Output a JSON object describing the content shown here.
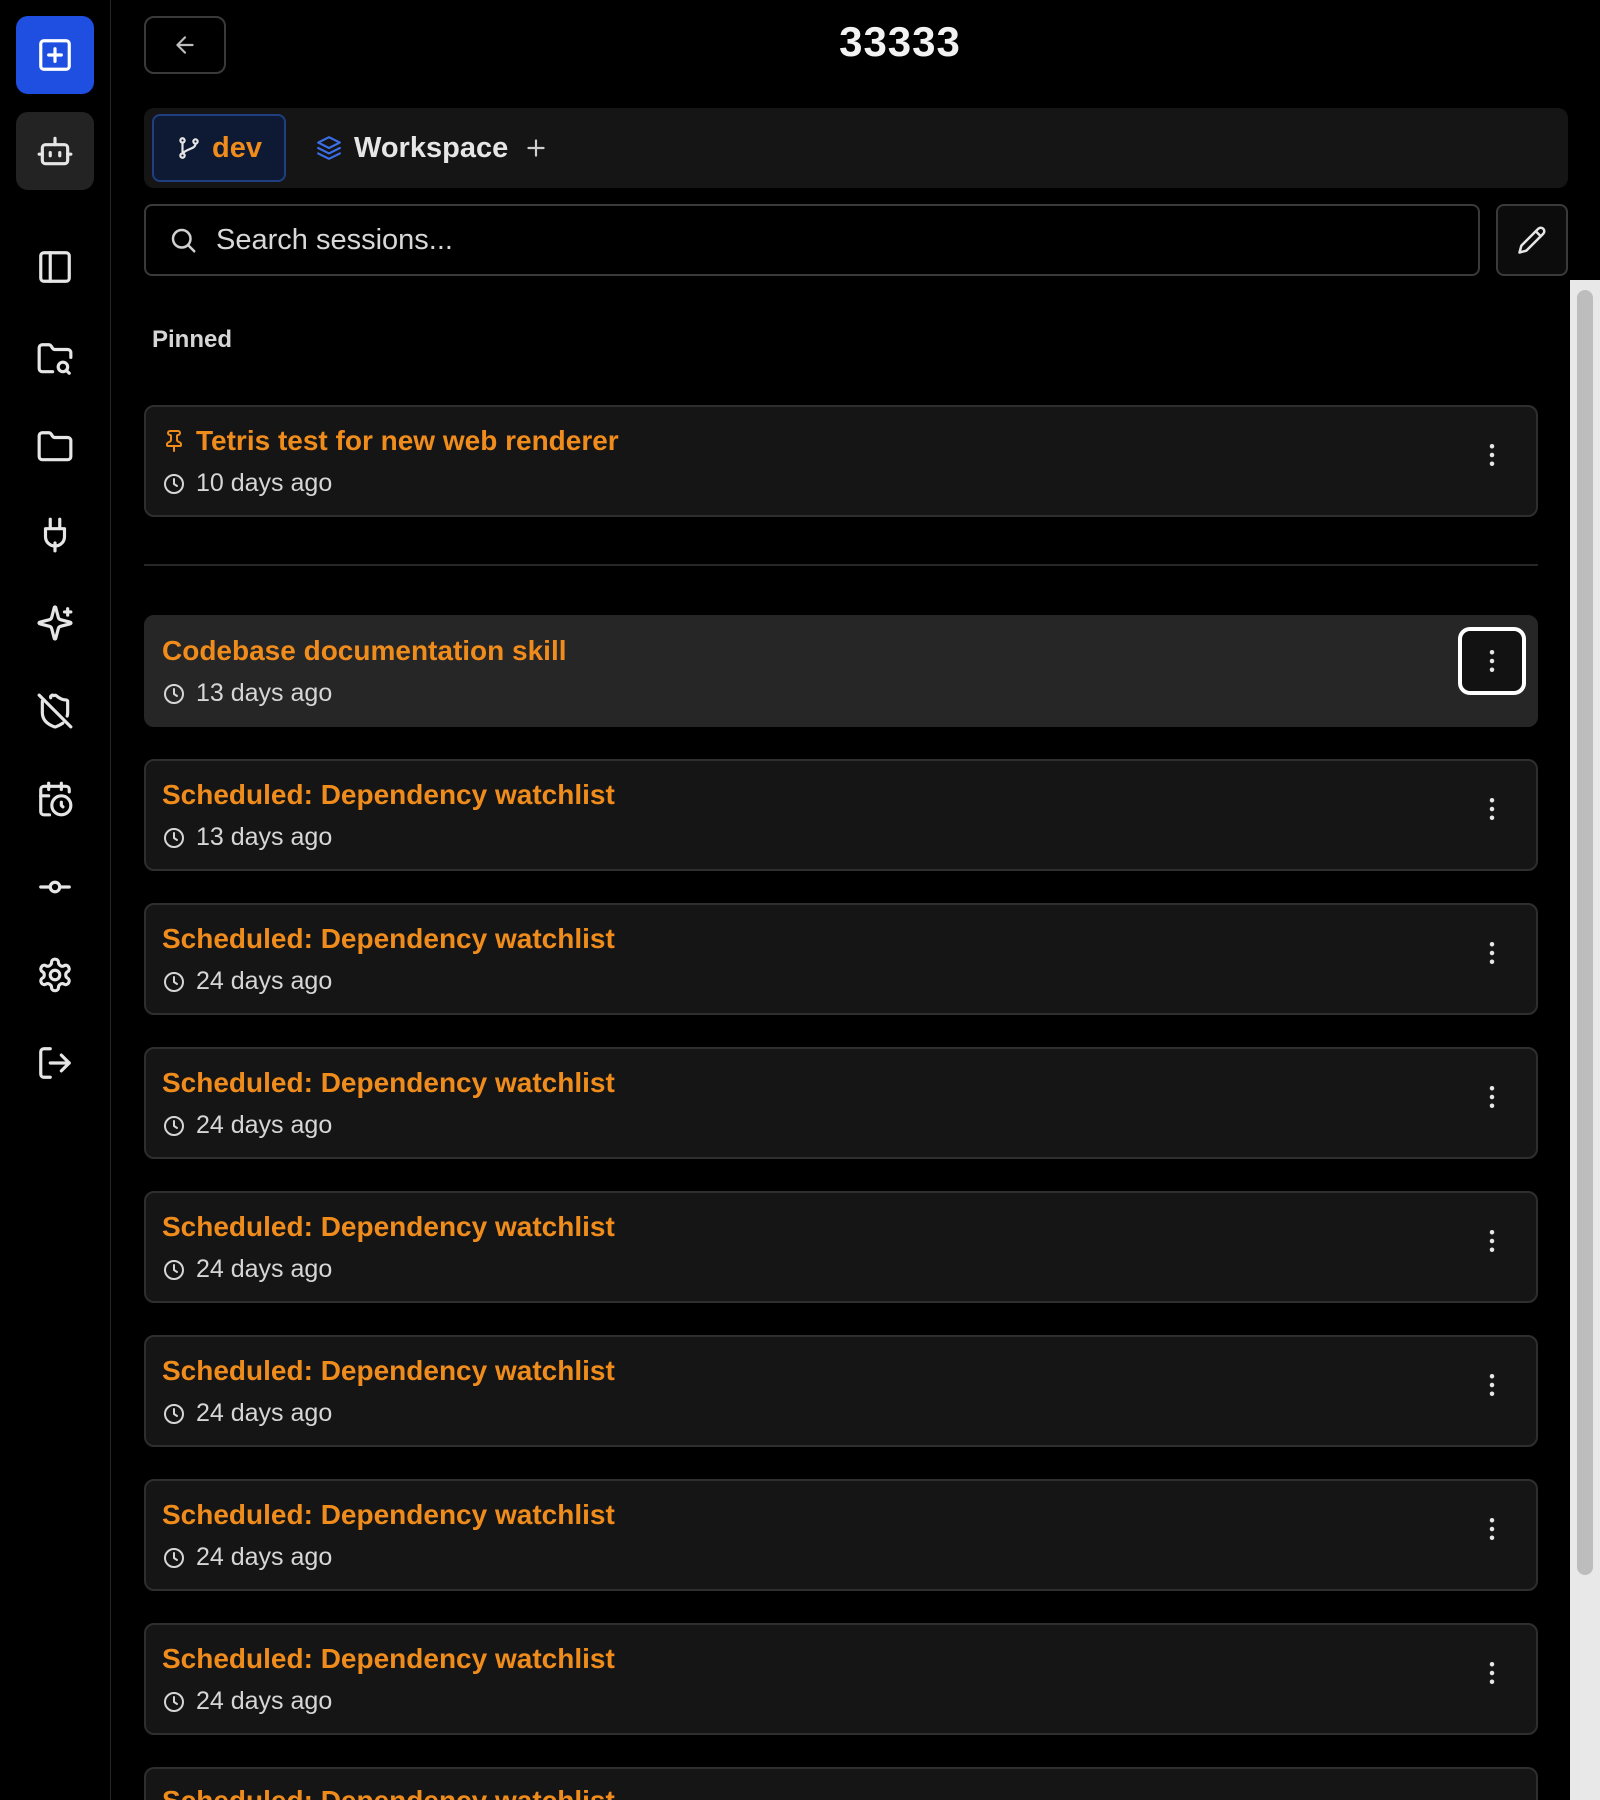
{
  "header": {
    "title": "33333"
  },
  "tabs": {
    "branch_label": "dev",
    "workspace_label": "Workspace"
  },
  "search": {
    "placeholder": "Search sessions..."
  },
  "sections": {
    "pinned_label": "Pinned"
  },
  "sessions": [
    {
      "title": "Tetris test for new web renderer",
      "time": "10 days ago",
      "pinned": true
    },
    {
      "title": "Codebase documentation skill",
      "time": "13 days ago",
      "pinned": false
    },
    {
      "title": "Scheduled: Dependency watchlist",
      "time": "13 days ago",
      "pinned": false
    },
    {
      "title": "Scheduled: Dependency watchlist",
      "time": "24 days ago",
      "pinned": false
    },
    {
      "title": "Scheduled: Dependency watchlist",
      "time": "24 days ago",
      "pinned": false
    },
    {
      "title": "Scheduled: Dependency watchlist",
      "time": "24 days ago",
      "pinned": false
    },
    {
      "title": "Scheduled: Dependency watchlist",
      "time": "24 days ago",
      "pinned": false
    },
    {
      "title": "Scheduled: Dependency watchlist",
      "time": "24 days ago",
      "pinned": false
    },
    {
      "title": "Scheduled: Dependency watchlist",
      "time": "24 days ago",
      "pinned": false
    },
    {
      "title": "Scheduled: Dependency watchlist",
      "time": "",
      "pinned": false
    }
  ],
  "rail": [
    "new-session-icon",
    "bot-icon",
    "sidebar-panel-icon",
    "folder-search-icon",
    "folder-icon",
    "plug-icon",
    "sparkles-icon",
    "shield-off-icon",
    "calendar-clock-icon",
    "git-commit-icon",
    "gear-icon",
    "logout-icon"
  ],
  "colors": {
    "accent": "#f08c1c",
    "primary": "#1f4fe0",
    "background": "#000000",
    "card": "#151515"
  }
}
